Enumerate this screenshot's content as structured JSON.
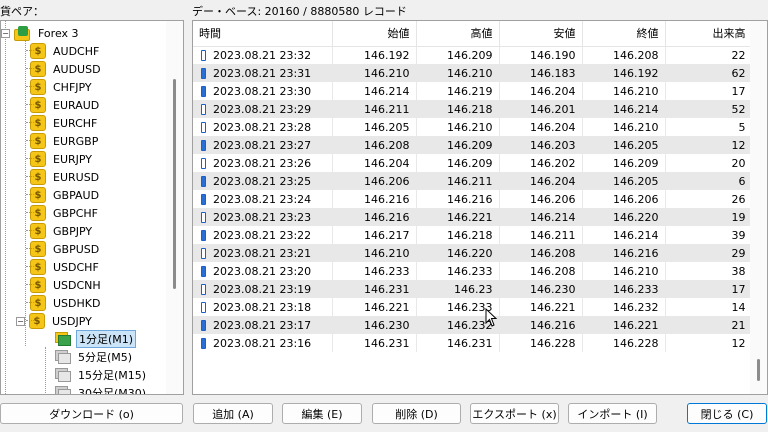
{
  "labels": {
    "pairs": "貨ペア：",
    "database": "デー・ベース: 20160 / 8880580 レコード"
  },
  "tree": {
    "root": "Forex 3",
    "symbols": [
      "AUDCHF",
      "AUDUSD",
      "CHFJPY",
      "EURAUD",
      "EURCHF",
      "EURGBP",
      "EURJPY",
      "EURUSD",
      "GBPAUD",
      "GBPCHF",
      "GBPJPY",
      "GBPUSD",
      "USDCHF",
      "USDCNH",
      "USDHKD",
      "USDJPY"
    ],
    "timeframes": [
      "1分足(M1)",
      "5分足(M5)",
      "15分足(M15)",
      "30分足(M30)"
    ],
    "selected_symbol": "USDJPY",
    "selected_timeframe": "1分足(M1)"
  },
  "table": {
    "columns": [
      "時間",
      "始値",
      "高値",
      "安値",
      "終値",
      "出来高"
    ],
    "rows": [
      {
        "time": "2023.08.21 23:32",
        "open": "146.192",
        "high": "146.209",
        "low": "146.190",
        "close": "146.208",
        "volume": "22"
      },
      {
        "time": "2023.08.21 23:31",
        "open": "146.210",
        "high": "146.210",
        "low": "146.183",
        "close": "146.192",
        "volume": "62"
      },
      {
        "time": "2023.08.21 23:30",
        "open": "146.214",
        "high": "146.219",
        "low": "146.204",
        "close": "146.210",
        "volume": "17"
      },
      {
        "time": "2023.08.21 23:29",
        "open": "146.211",
        "high": "146.218",
        "low": "146.201",
        "close": "146.214",
        "volume": "52"
      },
      {
        "time": "2023.08.21 23:28",
        "open": "146.205",
        "high": "146.210",
        "low": "146.204",
        "close": "146.210",
        "volume": "5"
      },
      {
        "time": "2023.08.21 23:27",
        "open": "146.208",
        "high": "146.209",
        "low": "146.203",
        "close": "146.205",
        "volume": "12"
      },
      {
        "time": "2023.08.21 23:26",
        "open": "146.204",
        "high": "146.209",
        "low": "146.202",
        "close": "146.209",
        "volume": "20"
      },
      {
        "time": "2023.08.21 23:25",
        "open": "146.206",
        "high": "146.211",
        "low": "146.204",
        "close": "146.205",
        "volume": "6"
      },
      {
        "time": "2023.08.21 23:24",
        "open": "146.216",
        "high": "146.216",
        "low": "146.206",
        "close": "146.206",
        "volume": "26"
      },
      {
        "time": "2023.08.21 23:23",
        "open": "146.216",
        "high": "146.221",
        "low": "146.214",
        "close": "146.220",
        "volume": "19"
      },
      {
        "time": "2023.08.21 23:22",
        "open": "146.217",
        "high": "146.218",
        "low": "146.211",
        "close": "146.214",
        "volume": "39"
      },
      {
        "time": "2023.08.21 23:21",
        "open": "146.210",
        "high": "146.220",
        "low": "146.208",
        "close": "146.216",
        "volume": "29"
      },
      {
        "time": "2023.08.21 23:20",
        "open": "146.233",
        "high": "146.233",
        "low": "146.208",
        "close": "146.210",
        "volume": "38"
      },
      {
        "time": "2023.08.21 23:19",
        "open": "146.231",
        "high": "146.23",
        "low": "146.230",
        "close": "146.233",
        "volume": "17"
      },
      {
        "time": "2023.08.21 23:18",
        "open": "146.221",
        "high": "146.233",
        "low": "146.221",
        "close": "146.232",
        "volume": "14"
      },
      {
        "time": "2023.08.21 23:17",
        "open": "146.230",
        "high": "146.232",
        "low": "146.216",
        "close": "146.221",
        "volume": "21"
      },
      {
        "time": "2023.08.21 23:16",
        "open": "146.231",
        "high": "146.231",
        "low": "146.228",
        "close": "146.228",
        "volume": "12"
      }
    ]
  },
  "buttons": {
    "download": "ダウンロード (o)",
    "add": "追加 (A)",
    "edit": "編集 (E)",
    "delete": "削除 (D)",
    "export": "エクスポート (x)",
    "import": "インポート (I)",
    "close": "閉じる (C)"
  },
  "colors": {
    "candle_up_fill": "#ffffff",
    "candle_down_fill": "#2a6fd6",
    "coin": "#f5c518",
    "selection": "#cce4f7"
  }
}
